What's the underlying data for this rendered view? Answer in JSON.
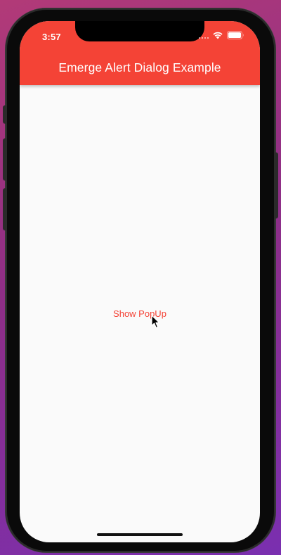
{
  "status_bar": {
    "time": "3:57",
    "icons": [
      "signal-dots-icon",
      "wifi-icon",
      "battery-icon"
    ]
  },
  "app_bar": {
    "title": "Emerge Alert Dialog Example"
  },
  "main": {
    "show_popup_label": "Show PopUp"
  },
  "colors": {
    "primary": "#f44336",
    "background": "#fafafa",
    "on_primary": "#ffffff"
  }
}
